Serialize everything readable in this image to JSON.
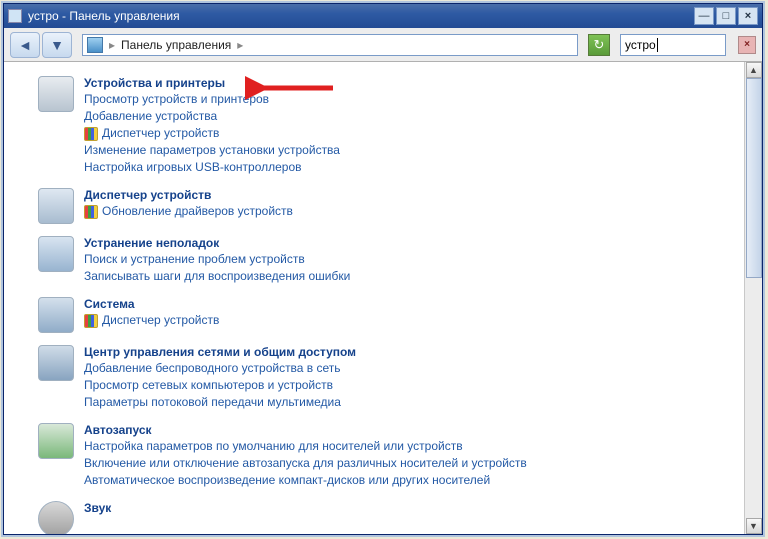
{
  "window": {
    "title": "устро - Панель управления",
    "min_label": "—",
    "max_label": "□",
    "close_label": "×"
  },
  "addressbar": {
    "back_glyph": "◄",
    "fwd_glyph": "▼",
    "breadcrumb_text": "Панель управления",
    "breadcrumb_sep1": "▸",
    "breadcrumb_sep2": "▸",
    "refresh_glyph": "↻",
    "search_value": "устро",
    "search_close_glyph": "×"
  },
  "categories": [
    {
      "title": "Устройства и принтеры",
      "icon": "printer",
      "links": [
        {
          "text": "Просмотр устройств и принтеров",
          "icon": null
        },
        {
          "text": "Добавление устройства",
          "icon": null
        },
        {
          "text": "Диспетчер устройств",
          "icon": "shield"
        },
        {
          "text": "Изменение параметров установки устройства",
          "icon": null
        },
        {
          "text": "Настройка игровых USB-контроллеров",
          "icon": null
        }
      ]
    },
    {
      "title": "Диспетчер устройств",
      "icon": "devmgr",
      "links": [
        {
          "text": "Обновление драйверов устройств",
          "icon": "shield"
        }
      ]
    },
    {
      "title": "Устранение неполадок",
      "icon": "trouble",
      "links": [
        {
          "text": "Поиск и устранение проблем устройств",
          "icon": null
        },
        {
          "text": "Записывать шаги для воспроизведения ошибки",
          "icon": null
        }
      ]
    },
    {
      "title": "Система",
      "icon": "system",
      "links": [
        {
          "text": "Диспетчер устройств",
          "icon": "shield"
        }
      ]
    },
    {
      "title": "Центр управления сетями и общим доступом",
      "icon": "network",
      "links": [
        {
          "text": "Добавление беспроводного устройства в сеть",
          "icon": null
        },
        {
          "text": "Просмотр сетевых компьютеров и устройств",
          "icon": null
        },
        {
          "text": "Параметры потоковой передачи мультимедиа",
          "icon": null
        }
      ]
    },
    {
      "title": "Автозапуск",
      "icon": "autoplay",
      "links": [
        {
          "text": "Настройка параметров по умолчанию для носителей или устройств",
          "icon": null
        },
        {
          "text": "Включение или отключение автозапуска для различных носителей и устройств",
          "icon": null
        },
        {
          "text": "Автоматическое воспроизведение компакт-дисков или других носителей",
          "icon": null
        }
      ]
    },
    {
      "title": "Звук",
      "icon": "sound",
      "links": []
    }
  ],
  "scrollbar": {
    "up_glyph": "▲",
    "down_glyph": "▼"
  }
}
